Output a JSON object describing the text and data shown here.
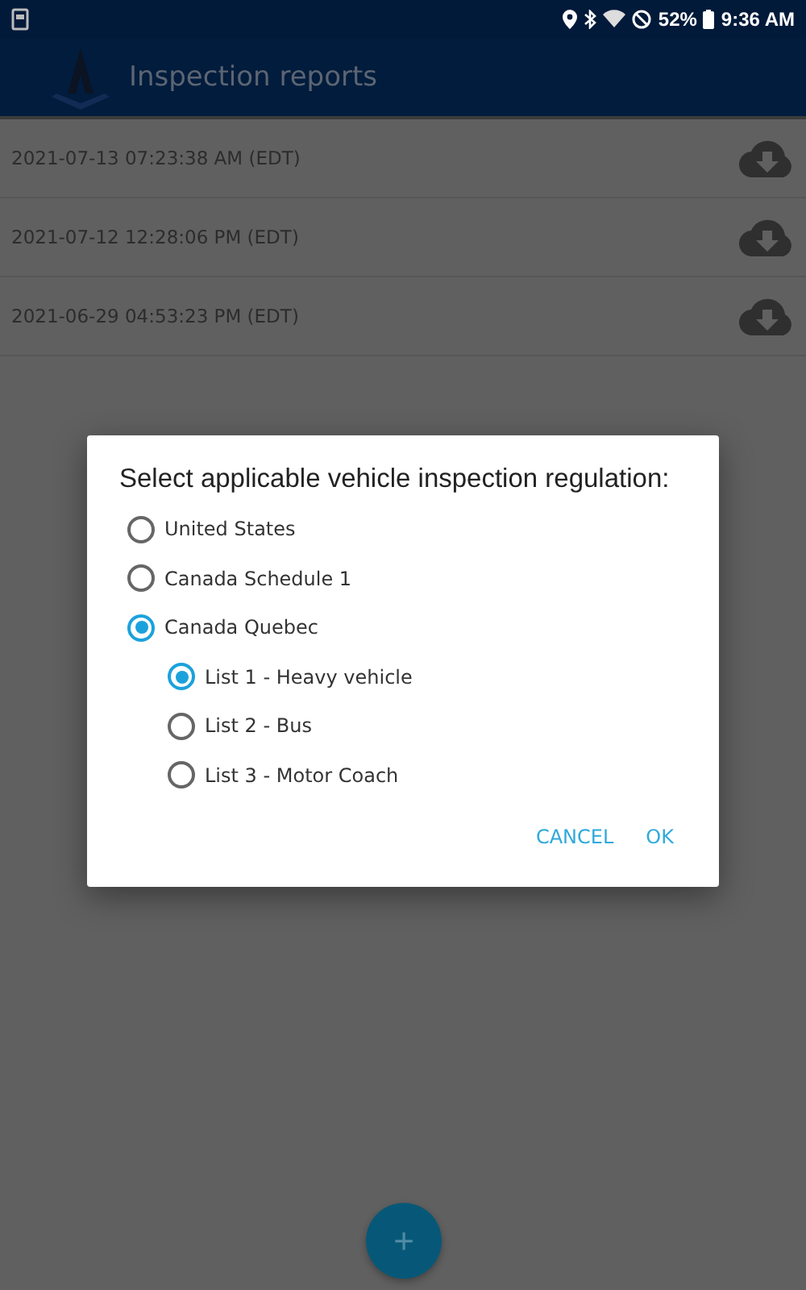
{
  "status_bar": {
    "battery": "52%",
    "time": "9:36 AM"
  },
  "app_bar": {
    "title": "Inspection reports"
  },
  "reports": [
    {
      "timestamp": "2021-07-13 07:23:38 AM (EDT)"
    },
    {
      "timestamp": "2021-07-12 12:28:06 PM (EDT)"
    },
    {
      "timestamp": "2021-06-29 04:53:23 PM (EDT)"
    }
  ],
  "fab": {
    "label": "+"
  },
  "dialog": {
    "title": "Select applicable vehicle inspection regulation:",
    "options": [
      {
        "label": "United States",
        "selected": false
      },
      {
        "label": "Canada Schedule 1",
        "selected": false
      },
      {
        "label": "Canada Quebec",
        "selected": true,
        "children": [
          {
            "label": "List 1 - Heavy vehicle",
            "selected": true
          },
          {
            "label": "List 2 - Bus",
            "selected": false
          },
          {
            "label": "List 3 - Motor Coach",
            "selected": false
          }
        ]
      }
    ],
    "buttons": [
      "CANCEL",
      "OK"
    ]
  }
}
